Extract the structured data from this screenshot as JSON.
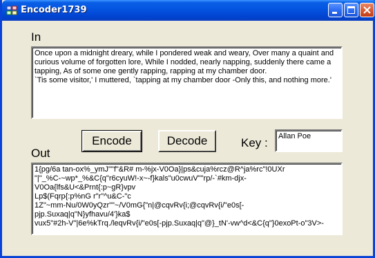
{
  "window": {
    "title": "Encoder1739",
    "controls": [
      "minimize",
      "maximize",
      "close"
    ]
  },
  "in_section": {
    "label": "In",
    "text": "Once upon a midnight dreary, while I pondered weak and weary, Over many a quaint and curious volume of forgotten lore, While I nodded, nearly napping, suddenly there came a tapping, As of some one gently rapping, rapping at my chamber door.\n`Tis some visitor,' I muttered, `tapping at my chamber door -Only this, and nothing more.'"
  },
  "buttons": {
    "encode": "Encode",
    "decode": "Decode"
  },
  "key": {
    "label": "Key :",
    "value": "Allan Poe"
  },
  "out_section": {
    "label": "Out",
    "text": "1{pg/6a tan-ox%_ymJ\"\"f\"&R# m-%jx-V0Oa}|ps&cuja%rcz@R^ja%rc\"!0UXr\n\"|\"_%C-~wp*_%&C{q\"r6cyuW!-x~-f}kals\"u0cwuV\"\"rp/-`#km-djx-V0Oa{lfs&U<&Prnt{:p~gR}vpv\nLp$(Fqrp{:p%nG r\"r\"^u&C-\"c\n1Z\"~mm-Nu/0W0yQzr\"\"~/V0mG{\"n|@cqvRv{i;@cqvRv{i/\"e0s[-pjp.Suxaq|q\"N}yfhavu/4'}ka$\nvux5\"#2h-V\"|6e%kTrq./leqvRv{i/\"e0s[-pjp.Suxaq|q\"@}_tN'-vw^d<&C{q\"}0exoPt-o\"3V>-"
  },
  "colors": {
    "face": "#ece9d8",
    "titlebar": "#0454e0",
    "close_button": "#d75a33"
  }
}
